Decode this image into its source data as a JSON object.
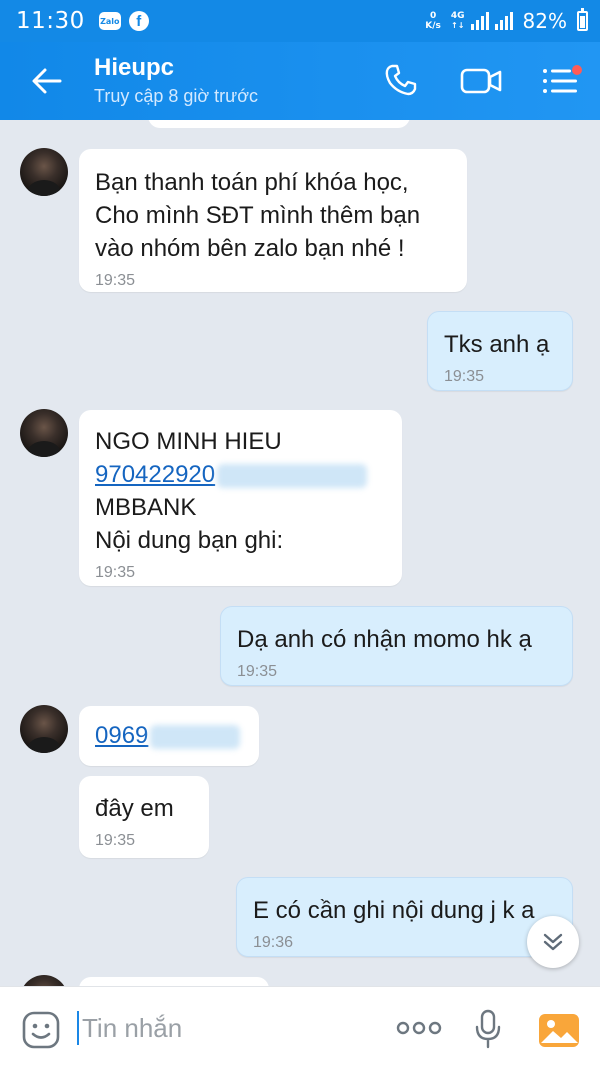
{
  "statusbar": {
    "time": "11:30",
    "app_badge": "Zalo",
    "fb_badge": "f",
    "speed_value": "0",
    "speed_unit": "K/s",
    "network": "4G",
    "battery": "82%"
  },
  "header": {
    "contact_name": "Hieupc",
    "presence": "Truy cập 8 giờ trước"
  },
  "messages": [
    {
      "dir": "in",
      "lines": [
        "Bạn thanh toán phí khóa học,",
        "Cho mình SĐT mình thêm bạn",
        "vào nhóm bên zalo bạn nhé !"
      ],
      "time": "19:35"
    },
    {
      "dir": "out",
      "lines": [
        "Tks anh ạ"
      ],
      "time": "19:35"
    },
    {
      "dir": "in",
      "lines": [
        "NGO MINH HIEU",
        "970422920",
        "MBBANK",
        "Nội dung bạn ghi:"
      ],
      "time": "19:35"
    },
    {
      "dir": "out",
      "lines": [
        "Dạ anh có nhận momo hk ạ"
      ],
      "time": "19:35"
    },
    {
      "dir": "in",
      "lines": [
        "0969"
      ]
    },
    {
      "dir": "in",
      "lines": [
        "đây em"
      ],
      "time": "19:35"
    },
    {
      "dir": "out",
      "lines": [
        "E có cần ghi nội dung j k a"
      ],
      "time": "19:36"
    }
  ],
  "input": {
    "placeholder": "Tin nhắn"
  },
  "colors": {
    "header": "#1a8ceb",
    "chat_bg": "#e3e8ef",
    "outgoing_bubble": "#d8eefd",
    "incoming_bubble": "#ffffff",
    "link": "#1565c0"
  },
  "icons": [
    "back-arrow-icon",
    "phone-icon",
    "video-call-icon",
    "menu-icon",
    "chevron-down-icon",
    "emoji-icon",
    "more-icon",
    "microphone-icon",
    "image-icon"
  ]
}
